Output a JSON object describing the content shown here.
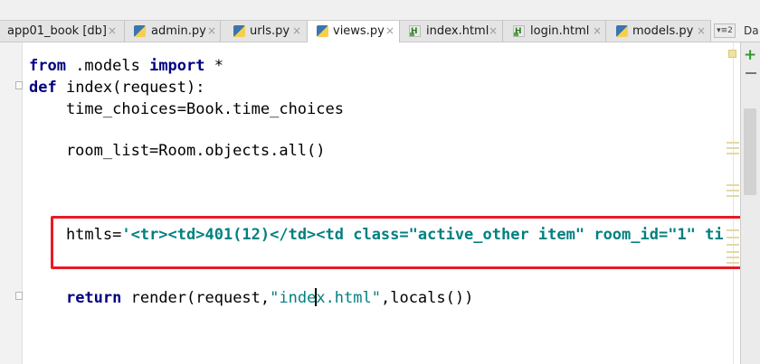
{
  "tabs": [
    {
      "label": "app01_book [db]",
      "icon": "database-icon"
    },
    {
      "label": "admin.py",
      "icon": "python-file-icon"
    },
    {
      "label": "urls.py",
      "icon": "python-file-icon"
    },
    {
      "label": "views.py",
      "icon": "python-file-icon",
      "active": true
    },
    {
      "label": "index.html",
      "icon": "html-file-icon"
    },
    {
      "label": "login.html",
      "icon": "html-file-icon"
    },
    {
      "label": "models.py",
      "icon": "python-file-icon"
    }
  ],
  "tab_close_glyph": "×",
  "tab_overflow_label": "▾≡2",
  "side_tab_label": "Da",
  "code": {
    "l1": {
      "kw1": "from",
      "mid": " .models ",
      "kw2": "import",
      "tail": " *"
    },
    "l2": {
      "kw": "def",
      "rest": " index(request):"
    },
    "l3": "    time_choices=Book.time_choices",
    "l5": "    room_list=Room.objects.all()",
    "l8": {
      "pre": "    htmls=",
      "str": "'<tr><td>401(12)</td><td class=\"active_other item\" room_id=\"1\" ti"
    },
    "l10": {
      "indent": "    ",
      "kw": "return",
      "a": " render(request,",
      "s1": "\"inde",
      "s2": "x.html\"",
      "b": ",locals())"
    }
  },
  "colors": {
    "keyword": "#000080",
    "string": "#008080",
    "highlight_box": "#e81a24"
  }
}
